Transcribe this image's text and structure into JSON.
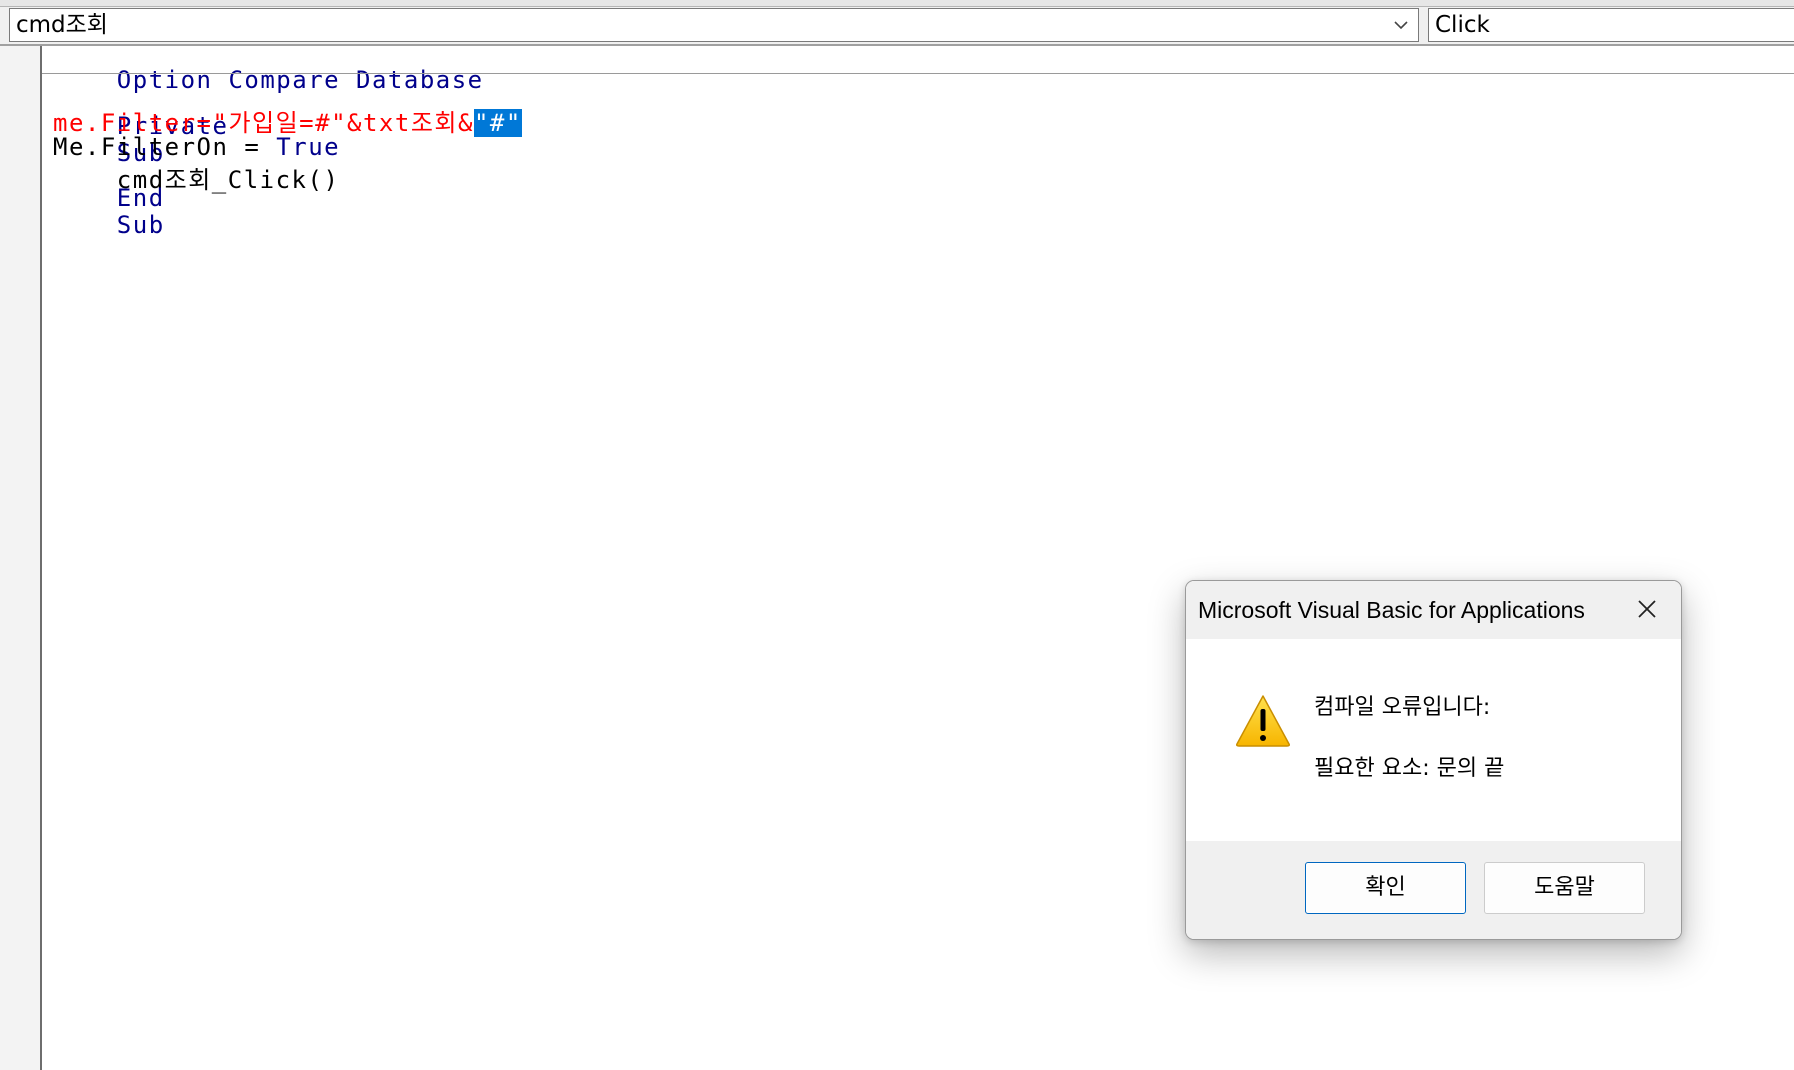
{
  "object_combo": {
    "value": "cmd조회"
  },
  "procedure_combo": {
    "value": "Click"
  },
  "code": {
    "declarations_line": "Option Compare Database",
    "sub_kw_private": "Private",
    "sub_kw_sub": "Sub",
    "sub_name": "cmd조회_Click()",
    "error_line_unselected": "me.Filter=\"가입일=#\"&txt조회&",
    "error_line_selected": "\"#\"",
    "filteron_text": "Me.FilterOn = ",
    "filteron_kw_true": "True",
    "end_kw_end": "End",
    "end_kw_sub": "Sub"
  },
  "dialog": {
    "title": "Microsoft Visual Basic for Applications",
    "message_line1": "컴파일 오류입니다:",
    "message_line2": "필요한 요소: 문의 끝",
    "ok_label": "확인",
    "help_label": "도움말",
    "icon": "warning-icon"
  },
  "colors": {
    "keyword": "#00008b",
    "error_text": "#ff0000",
    "selection": "#0078d7",
    "dialog_title_bg": "#f0f0f0",
    "default_button_border": "#0067c0",
    "warning_fill": "#ffcc00"
  }
}
